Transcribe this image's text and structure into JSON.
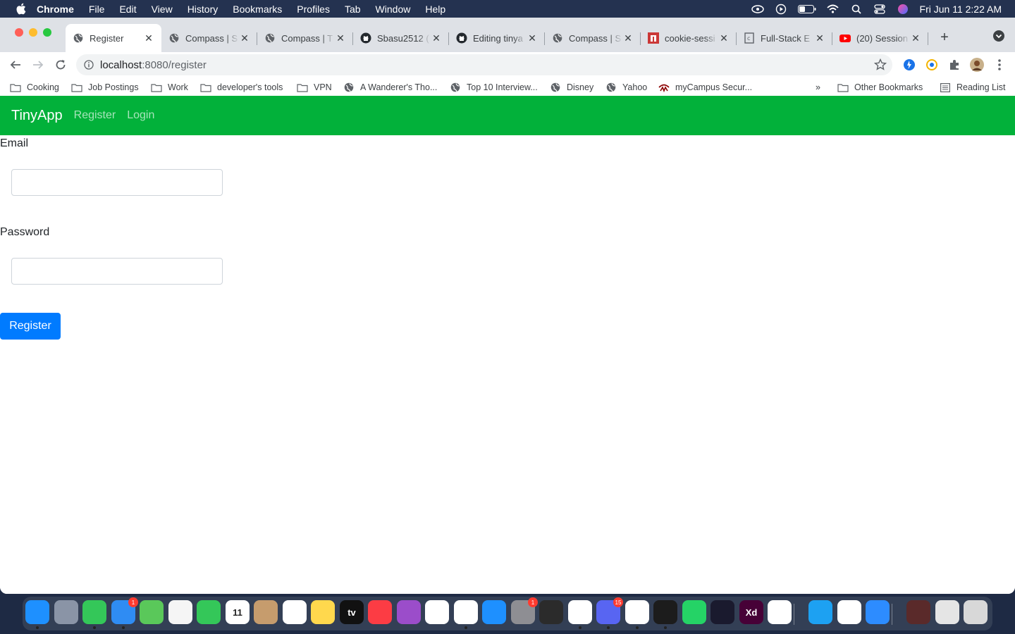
{
  "menubar": {
    "app": "Chrome",
    "items": [
      "File",
      "Edit",
      "View",
      "History",
      "Bookmarks",
      "Profiles",
      "Tab",
      "Window",
      "Help"
    ],
    "datetime": "Fri Jun 11  2:22 AM"
  },
  "tabs": [
    {
      "label": "Register",
      "icon": "globe-icon"
    },
    {
      "label": "Compass | S",
      "icon": "globe-icon"
    },
    {
      "label": "Compass | T",
      "icon": "globe-icon"
    },
    {
      "label": "Sbasu2512 (",
      "icon": "github-icon"
    },
    {
      "label": "Editing tinya",
      "icon": "github-icon"
    },
    {
      "label": "Compass | S",
      "icon": "globe-icon"
    },
    {
      "label": "cookie-sessi",
      "icon": "npm-icon"
    },
    {
      "label": "Full-Stack E",
      "icon": "doc-icon"
    },
    {
      "label": "(20) Session",
      "icon": "youtube-icon"
    }
  ],
  "address": {
    "host": "localhost",
    "rest": ":8080/register"
  },
  "bookmarks": [
    {
      "label": "Cooking",
      "icon": "folder-icon"
    },
    {
      "label": "Job Postings",
      "icon": "folder-icon"
    },
    {
      "label": "Work",
      "icon": "folder-icon"
    },
    {
      "label": "developer's tools",
      "icon": "folder-icon"
    },
    {
      "label": "VPN",
      "icon": "folder-icon"
    },
    {
      "label": "A Wanderer's Tho...",
      "icon": "globe-icon"
    },
    {
      "label": "Top 10 Interview...",
      "icon": "globe-icon"
    },
    {
      "label": "Disney",
      "icon": "globe-icon"
    },
    {
      "label": "Yahoo",
      "icon": "globe-icon"
    },
    {
      "label": "myCampus Secur...",
      "icon": "campus-icon"
    }
  ],
  "bookmarks_right": {
    "overflow": "»",
    "other": "Other Bookmarks",
    "reading": "Reading List"
  },
  "app": {
    "brand": "TinyApp",
    "nav": [
      "Register",
      "Login"
    ],
    "email_label": "Email",
    "email_value": "",
    "password_label": "Password",
    "password_value": "",
    "submit_label": "Register",
    "navbar_color": "#02b13a",
    "button_color": "#007bff"
  },
  "dock": [
    {
      "name": "finder-icon",
      "color": "#1e90ff"
    },
    {
      "name": "launchpad-icon",
      "color": "#8a94a6"
    },
    {
      "name": "messages-icon",
      "color": "#34c759"
    },
    {
      "name": "mail-icon",
      "color": "#2f8cf3",
      "badge": "1"
    },
    {
      "name": "maps-icon",
      "color": "#5ac85a"
    },
    {
      "name": "photos-icon",
      "color": "#f5f5f5"
    },
    {
      "name": "facetime-icon",
      "color": "#34c759"
    },
    {
      "name": "calendar-icon",
      "color": "#ffffff",
      "text": "11"
    },
    {
      "name": "contacts-icon",
      "color": "#c69c6d"
    },
    {
      "name": "reminders-icon",
      "color": "#ffffff"
    },
    {
      "name": "notes-icon",
      "color": "#ffd84d"
    },
    {
      "name": "appletv-icon",
      "color": "#111111",
      "text": "tv"
    },
    {
      "name": "music-icon",
      "color": "#fc3c44"
    },
    {
      "name": "podcasts-icon",
      "color": "#9b4dca"
    },
    {
      "name": "news-icon",
      "color": "#ffffff"
    },
    {
      "name": "chrome-icon",
      "color": "#ffffff"
    },
    {
      "name": "appstore-icon",
      "color": "#1e90ff"
    },
    {
      "name": "system-preferences-icon",
      "color": "#8e8e93",
      "badge": "1"
    },
    {
      "name": "quicktime-icon",
      "color": "#2b2b2b"
    },
    {
      "name": "slack-icon",
      "color": "#ffffff"
    },
    {
      "name": "discord-icon",
      "color": "#5865f2",
      "badge": "15"
    },
    {
      "name": "vscode-icon",
      "color": "#ffffff"
    },
    {
      "name": "terminal-icon",
      "color": "#1c1c1c"
    },
    {
      "name": "whatsapp-icon",
      "color": "#25d366"
    },
    {
      "name": "screen-icon",
      "color": "#1a1a2e"
    },
    {
      "name": "adobe-xd-icon",
      "color": "#470137",
      "text": "Xd"
    },
    {
      "name": "messenger-icon",
      "color": "#ffffff"
    },
    {
      "name": "twitter-icon",
      "color": "#1da1f2"
    },
    {
      "name": "creative-cloud-icon",
      "color": "#ffffff"
    },
    {
      "name": "zoom-icon",
      "color": "#2d8cff"
    },
    {
      "name": "image-thumbnail-icon",
      "color": "#5a2a2a"
    },
    {
      "name": "downloads-stack-icon",
      "color": "#e5e5e5"
    },
    {
      "name": "trash-icon",
      "color": "#d8d8d8"
    }
  ]
}
